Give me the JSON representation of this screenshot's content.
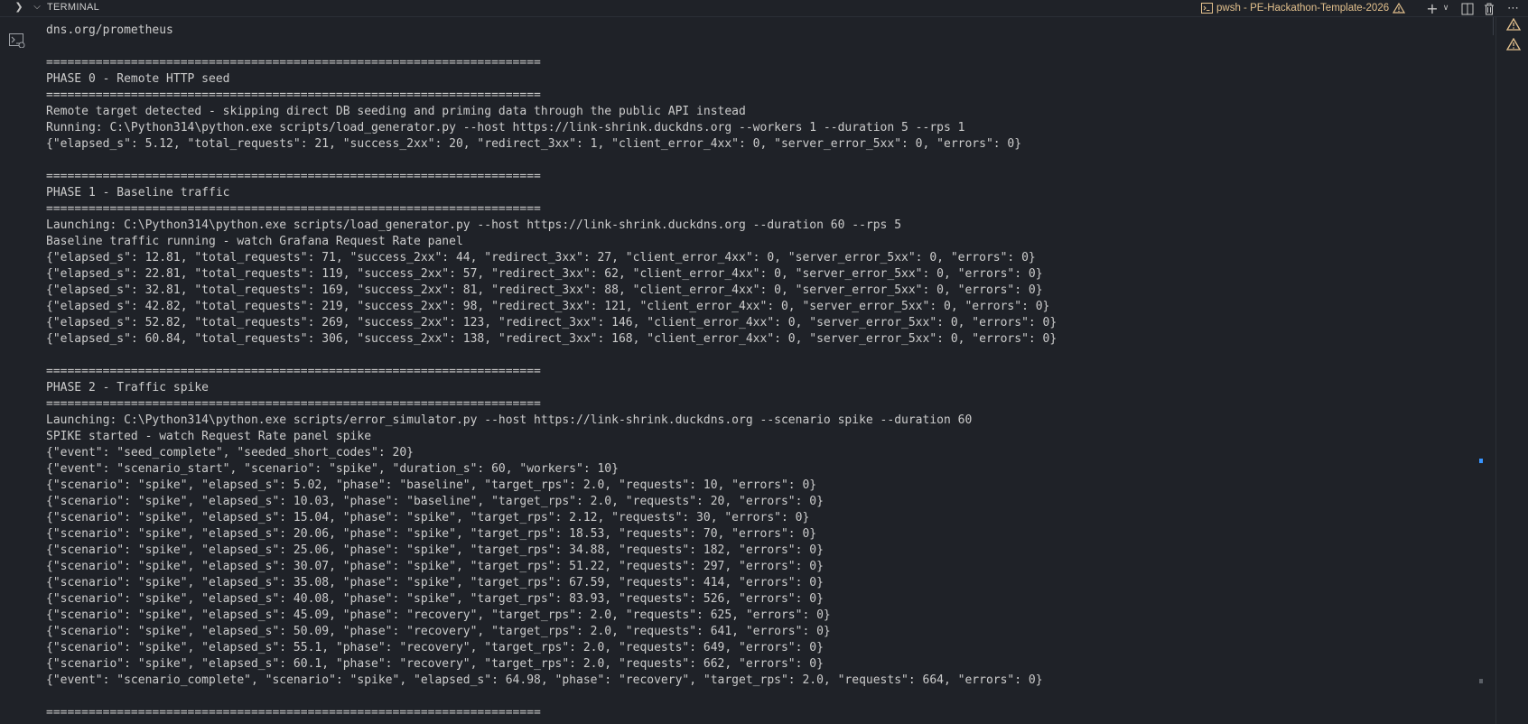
{
  "panel": {
    "title": "TERMINAL",
    "active_terminal": "pwsh - PE-Hackathon-Template-2026"
  },
  "icons": {
    "collapse": "chevron-right-icon",
    "expand": "chevron-down-icon",
    "shell": "terminal-shell-icon",
    "warning": "warning-icon",
    "new_terminal": "plus-icon",
    "dropdown": "chevron-down-icon",
    "split": "split-icon",
    "trash": "trash-icon",
    "more": "ellipsis-icon"
  },
  "colors": {
    "background": "#1f2228",
    "text": "#cccccc",
    "accent_warning": "#e2c08d",
    "scroll_marker": "#3794ff"
  },
  "output_lines": [
    "dns.org/prometheus",
    "",
    "======================================================================",
    "PHASE 0 - Remote HTTP seed",
    "======================================================================",
    "Remote target detected - skipping direct DB seeding and priming data through the public API instead",
    "Running: C:\\Python314\\python.exe scripts/load_generator.py --host https://link-shrink.duckdns.org --workers 1 --duration 5 --rps 1",
    "{\"elapsed_s\": 5.12, \"total_requests\": 21, \"success_2xx\": 20, \"redirect_3xx\": 1, \"client_error_4xx\": 0, \"server_error_5xx\": 0, \"errors\": 0}",
    "",
    "======================================================================",
    "PHASE 1 - Baseline traffic",
    "======================================================================",
    "Launching: C:\\Python314\\python.exe scripts/load_generator.py --host https://link-shrink.duckdns.org --duration 60 --rps 5",
    "Baseline traffic running - watch Grafana Request Rate panel",
    "{\"elapsed_s\": 12.81, \"total_requests\": 71, \"success_2xx\": 44, \"redirect_3xx\": 27, \"client_error_4xx\": 0, \"server_error_5xx\": 0, \"errors\": 0}",
    "{\"elapsed_s\": 22.81, \"total_requests\": 119, \"success_2xx\": 57, \"redirect_3xx\": 62, \"client_error_4xx\": 0, \"server_error_5xx\": 0, \"errors\": 0}",
    "{\"elapsed_s\": 32.81, \"total_requests\": 169, \"success_2xx\": 81, \"redirect_3xx\": 88, \"client_error_4xx\": 0, \"server_error_5xx\": 0, \"errors\": 0}",
    "{\"elapsed_s\": 42.82, \"total_requests\": 219, \"success_2xx\": 98, \"redirect_3xx\": 121, \"client_error_4xx\": 0, \"server_error_5xx\": 0, \"errors\": 0}",
    "{\"elapsed_s\": 52.82, \"total_requests\": 269, \"success_2xx\": 123, \"redirect_3xx\": 146, \"client_error_4xx\": 0, \"server_error_5xx\": 0, \"errors\": 0}",
    "{\"elapsed_s\": 60.84, \"total_requests\": 306, \"success_2xx\": 138, \"redirect_3xx\": 168, \"client_error_4xx\": 0, \"server_error_5xx\": 0, \"errors\": 0}",
    "",
    "======================================================================",
    "PHASE 2 - Traffic spike",
    "======================================================================",
    "Launching: C:\\Python314\\python.exe scripts/error_simulator.py --host https://link-shrink.duckdns.org --scenario spike --duration 60",
    "SPIKE started - watch Request Rate panel spike",
    "{\"event\": \"seed_complete\", \"seeded_short_codes\": 20}",
    "{\"event\": \"scenario_start\", \"scenario\": \"spike\", \"duration_s\": 60, \"workers\": 10}",
    "{\"scenario\": \"spike\", \"elapsed_s\": 5.02, \"phase\": \"baseline\", \"target_rps\": 2.0, \"requests\": 10, \"errors\": 0}",
    "{\"scenario\": \"spike\", \"elapsed_s\": 10.03, \"phase\": \"baseline\", \"target_rps\": 2.0, \"requests\": 20, \"errors\": 0}",
    "{\"scenario\": \"spike\", \"elapsed_s\": 15.04, \"phase\": \"spike\", \"target_rps\": 2.12, \"requests\": 30, \"errors\": 0}",
    "{\"scenario\": \"spike\", \"elapsed_s\": 20.06, \"phase\": \"spike\", \"target_rps\": 18.53, \"requests\": 70, \"errors\": 0}",
    "{\"scenario\": \"spike\", \"elapsed_s\": 25.06, \"phase\": \"spike\", \"target_rps\": 34.88, \"requests\": 182, \"errors\": 0}",
    "{\"scenario\": \"spike\", \"elapsed_s\": 30.07, \"phase\": \"spike\", \"target_rps\": 51.22, \"requests\": 297, \"errors\": 0}",
    "{\"scenario\": \"spike\", \"elapsed_s\": 35.08, \"phase\": \"spike\", \"target_rps\": 67.59, \"requests\": 414, \"errors\": 0}",
    "{\"scenario\": \"spike\", \"elapsed_s\": 40.08, \"phase\": \"spike\", \"target_rps\": 83.93, \"requests\": 526, \"errors\": 0}",
    "{\"scenario\": \"spike\", \"elapsed_s\": 45.09, \"phase\": \"recovery\", \"target_rps\": 2.0, \"requests\": 625, \"errors\": 0}",
    "{\"scenario\": \"spike\", \"elapsed_s\": 50.09, \"phase\": \"recovery\", \"target_rps\": 2.0, \"requests\": 641, \"errors\": 0}",
    "{\"scenario\": \"spike\", \"elapsed_s\": 55.1, \"phase\": \"recovery\", \"target_rps\": 2.0, \"requests\": 649, \"errors\": 0}",
    "{\"scenario\": \"spike\", \"elapsed_s\": 60.1, \"phase\": \"recovery\", \"target_rps\": 2.0, \"requests\": 662, \"errors\": 0}",
    "{\"event\": \"scenario_complete\", \"scenario\": \"spike\", \"elapsed_s\": 64.98, \"phase\": \"recovery\", \"target_rps\": 2.0, \"requests\": 664, \"errors\": 0}",
    "",
    "======================================================================"
  ]
}
